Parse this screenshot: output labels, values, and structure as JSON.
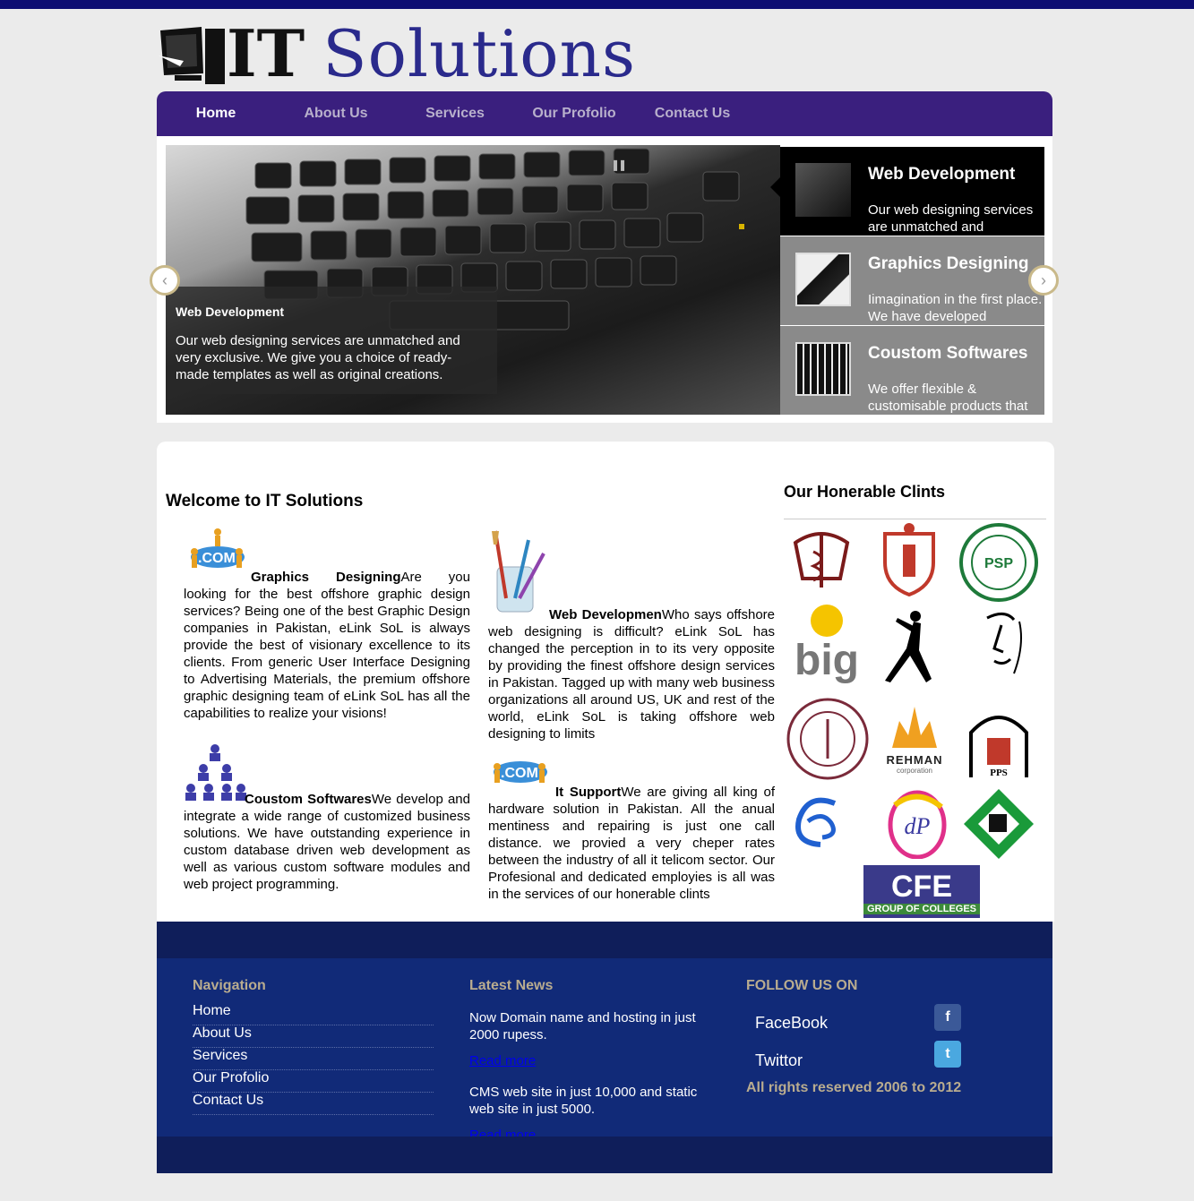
{
  "logo": {
    "it": "IT",
    "solutions": "Solutions"
  },
  "nav": {
    "items": [
      {
        "label": "Home",
        "active": true
      },
      {
        "label": "About Us"
      },
      {
        "label": "Services"
      },
      {
        "label": "Our Profolio"
      },
      {
        "label": "Contact Us"
      }
    ]
  },
  "slider": {
    "caption_title": "Web Development",
    "caption_text": "Our web designing services are unmatched and very exclusive. We give you a choice of ready-made templates as well as original creations.",
    "tabs": [
      {
        "title": "Web Development",
        "text": "Our web designing services are unmatched and",
        "active": true
      },
      {
        "title": "Graphics Designing",
        "text": "Iimagination in the first place. We have developed"
      },
      {
        "title": "Coustom Softwares",
        "text": "We offer flexible & customisable products that"
      }
    ]
  },
  "welcome": {
    "title": "Welcome to IT Solutions",
    "blocks": [
      {
        "title": "Graphics Designing",
        "text": "Are you looking for the best offshore graphic design services? Being one of the best Graphic Design companies in Pakistan, eLink SoL is always provide the best of visionary excellence to its clients. From generic User Interface Designing to Advertising Materials, the premium offshore graphic designing team of eLink SoL has all the capabilities to realize your visions!"
      },
      {
        "title": "Web Developmen",
        "text": "Who says offshore web designing is difficult? eLink SoL has changed the perception in to its very opposite by providing the finest offshore design services in Pakistan. Tagged up with many web business organizations all around US, UK and rest of the world, eLink SoL is taking offshore web designing to limits"
      },
      {
        "title": "Coustom Softwares",
        "text": "We develop and integrate a wide range of customized business solutions. We have outstanding experience in custom database driven web development as well as various custom software modules and web project programming."
      },
      {
        "title": "It Support",
        "text": "We are giving all king of hardware solution in Pakistan. All the anual mentiness and repairing is just one call distance. we provied a very cheper rates between the industry of all it telicom sector. Our Profesional and dedicated employies is all was in the services of our honerable clints"
      }
    ]
  },
  "clients": {
    "title": "Our Honerable Clints",
    "logos": [
      {
        "text": "",
        "icon": "caduceus-crest-icon"
      },
      {
        "text": "",
        "icon": "shield-crest-icon"
      },
      {
        "text": "PSP",
        "icon": "psp-seal-icon"
      },
      {
        "text": "big",
        "icon": "big-logo-icon"
      },
      {
        "text": "",
        "icon": "yoga-figure-icon"
      },
      {
        "text": "",
        "icon": "face-sketch-icon"
      },
      {
        "text": "",
        "icon": "medical-seal-icon"
      },
      {
        "text": "REHMAN",
        "sub": "corporation",
        "icon": "rehman-crown-icon"
      },
      {
        "text": "PPS",
        "icon": "pps-gate-icon"
      },
      {
        "text": "",
        "icon": "cs-swirl-icon"
      },
      {
        "text": "dP",
        "icon": "dp-circle-icon"
      },
      {
        "text": "",
        "icon": "green-diamond-icon"
      },
      {
        "text": "CFE",
        "sub": "GROUP OF COLLEGES",
        "icon": "cfe-logo-icon"
      }
    ]
  },
  "footer": {
    "nav_title": "Navigation",
    "nav_links": [
      "Home",
      "About Us",
      "Services",
      "Our Profolio",
      "Contact Us"
    ],
    "news_title": "Latest News",
    "news": [
      {
        "text": "Now Domain name and hosting in just 2000 rupess.",
        "link": "Read more"
      },
      {
        "text": "CMS web site in just 10,000 and static web site in just 5000.",
        "link": "Read more"
      }
    ],
    "follow_title": "FOLLOW US ON",
    "social": [
      {
        "label": "FaceBook",
        "icon": "facebook-icon",
        "glyph": "f",
        "color": "#3b5998"
      },
      {
        "label": "Twittor",
        "icon": "twitter-icon",
        "glyph": "t",
        "color": "#4aa8e0"
      }
    ],
    "copyright": "All rights reserved 2006 to 2012"
  }
}
